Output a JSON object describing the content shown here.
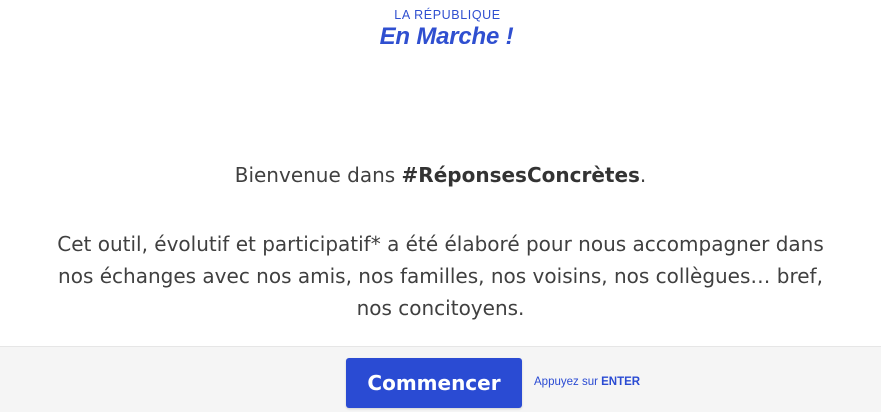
{
  "logo": {
    "top_text": "LA RÉPUBLIQUE",
    "main_text": "En Marche !"
  },
  "intro": {
    "welcome_prefix": "Bienvenue dans ",
    "welcome_hashtag": "#RéponsesConcrètes",
    "welcome_suffix": ".",
    "paragraph_lines": [
      "Cet outil, évolutif et participatif* a été élaboré pour nous accompagner dans",
      "nos échanges avec nos amis, nos familles, nos voisins, nos collègues… bref,",
      "nos concitoyens."
    ]
  },
  "footer": {
    "start_label": "Commencer",
    "hint_prefix": "Appuyez sur ",
    "hint_key": "ENTER"
  },
  "colors": {
    "accent": "#2a4bd3",
    "text": "#404040",
    "footer_bg": "#f5f5f5"
  }
}
